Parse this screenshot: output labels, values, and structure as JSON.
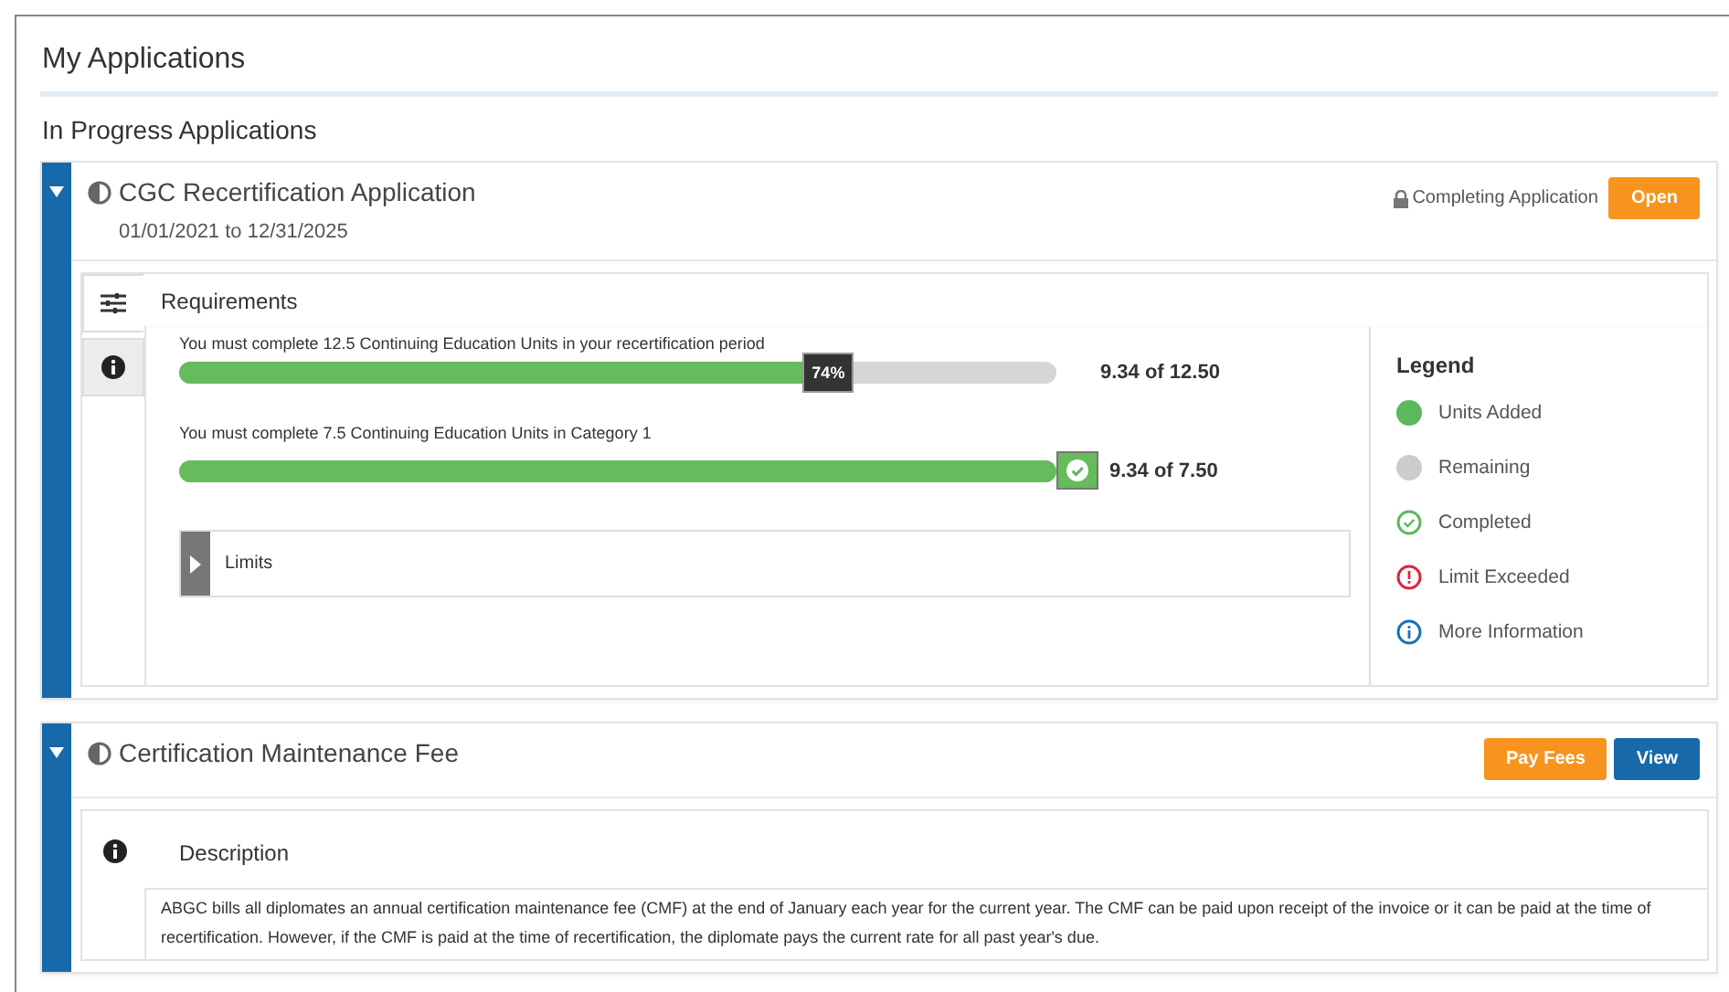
{
  "page_title": "My Applications",
  "section_title": "In Progress Applications",
  "applications": [
    {
      "title": "CGC Recertification Application",
      "expanded": true,
      "dates": "01/01/2021 to 12/31/2025",
      "status": "Completing Application",
      "buttons": [
        {
          "label": "Open",
          "kind": "orange"
        }
      ],
      "tabs": [
        {
          "kind": "sliders",
          "selected": true
        },
        {
          "kind": "info",
          "selected": false
        }
      ],
      "panel": {
        "kind": "requirements",
        "heading": "Requirements",
        "requirements": [
          {
            "text": "You must complete 12.5 Continuing Education Units in your recertification period",
            "level": 0.74,
            "kind": "percent",
            "badge": "74%",
            "reading": "9.34 of 12.50"
          },
          {
            "text": "You must complete 7.5 Continuing Education Units in Category 1",
            "level": 1,
            "kind": "completed",
            "reading": "9.34 of 7.50"
          }
        ],
        "limits": {
          "label": "Limits",
          "expanded": false
        },
        "legend": {
          "title": "Legend",
          "items": [
            {
              "label": "Units Added",
              "kind": "dot",
              "color": "#5cb85c"
            },
            {
              "label": "Remaining",
              "kind": "dot",
              "color": "#cccccc"
            },
            {
              "label": "Completed",
              "kind": "check",
              "color": "#5cb85c"
            },
            {
              "label": "Limit Exceeded",
              "kind": "alert",
              "color": "#d9263d"
            },
            {
              "label": "More Information",
              "kind": "info",
              "color": "#1a73b8"
            }
          ]
        }
      }
    },
    {
      "title": "Certification Maintenance Fee",
      "expanded": true,
      "buttons": [
        {
          "label": "Pay Fees",
          "kind": "orange"
        },
        {
          "label": "View",
          "kind": "blue"
        }
      ],
      "panel": {
        "kind": "description",
        "heading": "Description",
        "text": "ABGC bills all diplomates an annual certification maintenance fee (CMF) at the end of January each year for the current year. The CMF can be paid upon receipt of the invoice or it can be paid at the time of recertification. However, if the CMF is paid at the time of recertification, the diplomate pays the current rate for all past year's due."
      }
    }
  ]
}
